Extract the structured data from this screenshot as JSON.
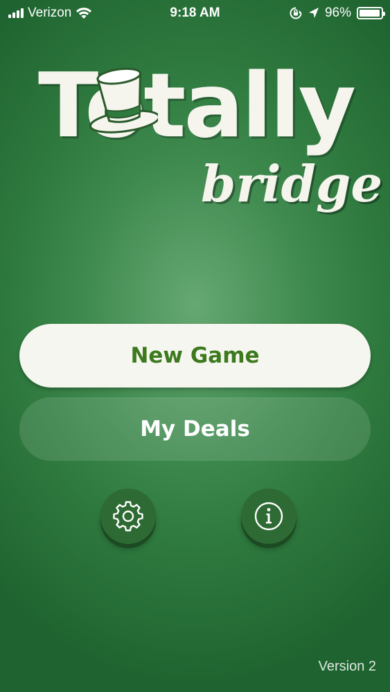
{
  "status_bar": {
    "carrier": "Verizon",
    "time": "9:18 AM",
    "battery_percent": "96%",
    "battery_level": 0.96,
    "icons": [
      "signal-icon",
      "wifi-icon",
      "orientation-lock-icon",
      "location-arrow-icon",
      "battery-icon"
    ]
  },
  "logo": {
    "word": "Totally",
    "subtitle": "bridge",
    "icon": "top-hat-icon"
  },
  "menu": {
    "new_game_label": "New Game",
    "my_deals_label": "My Deals",
    "settings_icon": "gear-icon",
    "info_icon": "info-icon"
  },
  "footer": {
    "version": "Version 2"
  },
  "colors": {
    "background": "#3f8a4f",
    "primary_button_bg": "#f6f6f1",
    "primary_button_text": "#3d7a1e",
    "round_button_bg": "#2e6a34"
  }
}
